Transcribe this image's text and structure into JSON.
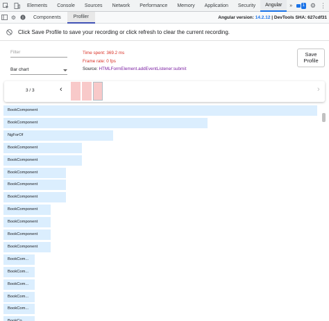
{
  "devtools_tabs": [
    "Elements",
    "Console",
    "Sources",
    "Network",
    "Performance",
    "Memory",
    "Application",
    "Security",
    "Angular"
  ],
  "active_tab": "Angular",
  "more_tabs_glyph": "»",
  "issues_count": "1",
  "angular_subtabs": [
    "Components",
    "Profiler"
  ],
  "angular_version_label": "Angular version:",
  "angular_version": "14.2.12",
  "devtools_sha_label": "| DevTools SHA: 627cdf31",
  "info_message": "Click Save Profile to save your recording or click refresh to clear the current recording.",
  "filter_placeholder": "Filter",
  "chart_select_value": "Bar chart",
  "stats": {
    "time_spent": "Time spent: 369.2 ms",
    "frame_rate": "Frame rate: 0 fps",
    "source_label": "Source:",
    "source_value": "HTMLFormElement.addEventListener:submit"
  },
  "save_button": "Save Profile",
  "frame_counter": "3 / 3",
  "bars": [
    {
      "label": "BookComponent",
      "value": 1.0
    },
    {
      "label": "BookComponent",
      "value": 0.65
    },
    {
      "label": "NgForOf",
      "value": 0.35
    },
    {
      "label": "BookComponent",
      "value": 0.25
    },
    {
      "label": "BookComponent",
      "value": 0.25
    },
    {
      "label": "BookComponent",
      "value": 0.2
    },
    {
      "label": "BookComponent",
      "value": 0.2
    },
    {
      "label": "BookComponent",
      "value": 0.2
    },
    {
      "label": "BookComponent",
      "value": 0.15
    },
    {
      "label": "BookComponent",
      "value": 0.15
    },
    {
      "label": "BookComponent",
      "value": 0.15
    },
    {
      "label": "BookComponent",
      "value": 0.15
    },
    {
      "label": "BookCom...",
      "value": 0.1
    },
    {
      "label": "BookCom...",
      "value": 0.1
    },
    {
      "label": "BookCom...",
      "value": 0.1
    },
    {
      "label": "BookCom...",
      "value": 0.1
    },
    {
      "label": "BookCom...",
      "value": 0.1
    },
    {
      "label": "BookCo...",
      "value": 0.1
    }
  ],
  "colors": {
    "accent": "#1a73e8",
    "bar": "#dbeefe",
    "frame": "#f8c9c9",
    "red_stat": "#d93025",
    "source": "#7b1fa2"
  }
}
